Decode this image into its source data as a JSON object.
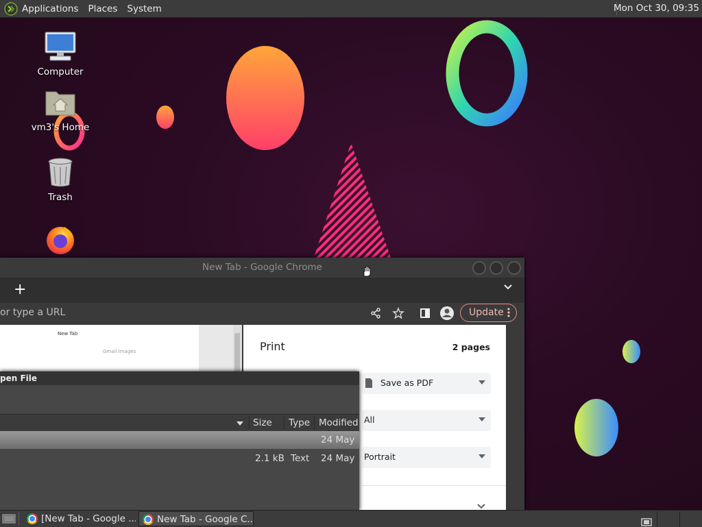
{
  "top_panel": {
    "menus": [
      "Applications",
      "Places",
      "System"
    ],
    "clock": "Mon Oct 30, 09:35"
  },
  "desktop": {
    "icons": [
      {
        "label": "Computer",
        "icon": "computer-icon"
      },
      {
        "label": "vm3's Home",
        "icon": "home-folder-icon"
      },
      {
        "label": "Trash",
        "icon": "trash-icon"
      },
      {
        "label": "",
        "icon": "firefox-icon"
      }
    ]
  },
  "chrome": {
    "title": "New Tab - Google Chrome",
    "newtab_symbol": "+",
    "omnibox_placeholder": "or type a URL",
    "update_label": "Update",
    "preview": {
      "page_title": "New Tab",
      "links": "Gmail   Images"
    },
    "print": {
      "title": "Print",
      "pages": "2 pages",
      "destination": "Save as PDF",
      "pages_option": "All",
      "layout": "Portrait"
    }
  },
  "open_file": {
    "title": "pen File",
    "columns": [
      "Size",
      "Type",
      "Modified"
    ],
    "rows": [
      {
        "size": "",
        "type": "",
        "modified": "24 May",
        "selected": true
      },
      {
        "size": "2.1 kB",
        "type": "Text",
        "modified": "24 May",
        "selected": false
      }
    ]
  },
  "taskbar": {
    "tasks": [
      {
        "label": "[New Tab - Google ...",
        "active": false
      },
      {
        "label": "New Tab - Google C...",
        "active": true
      }
    ]
  },
  "colors": {
    "panel": "#3c3c3c",
    "update_accent": "#e68b87",
    "wallpaper": "#2b0b24"
  }
}
